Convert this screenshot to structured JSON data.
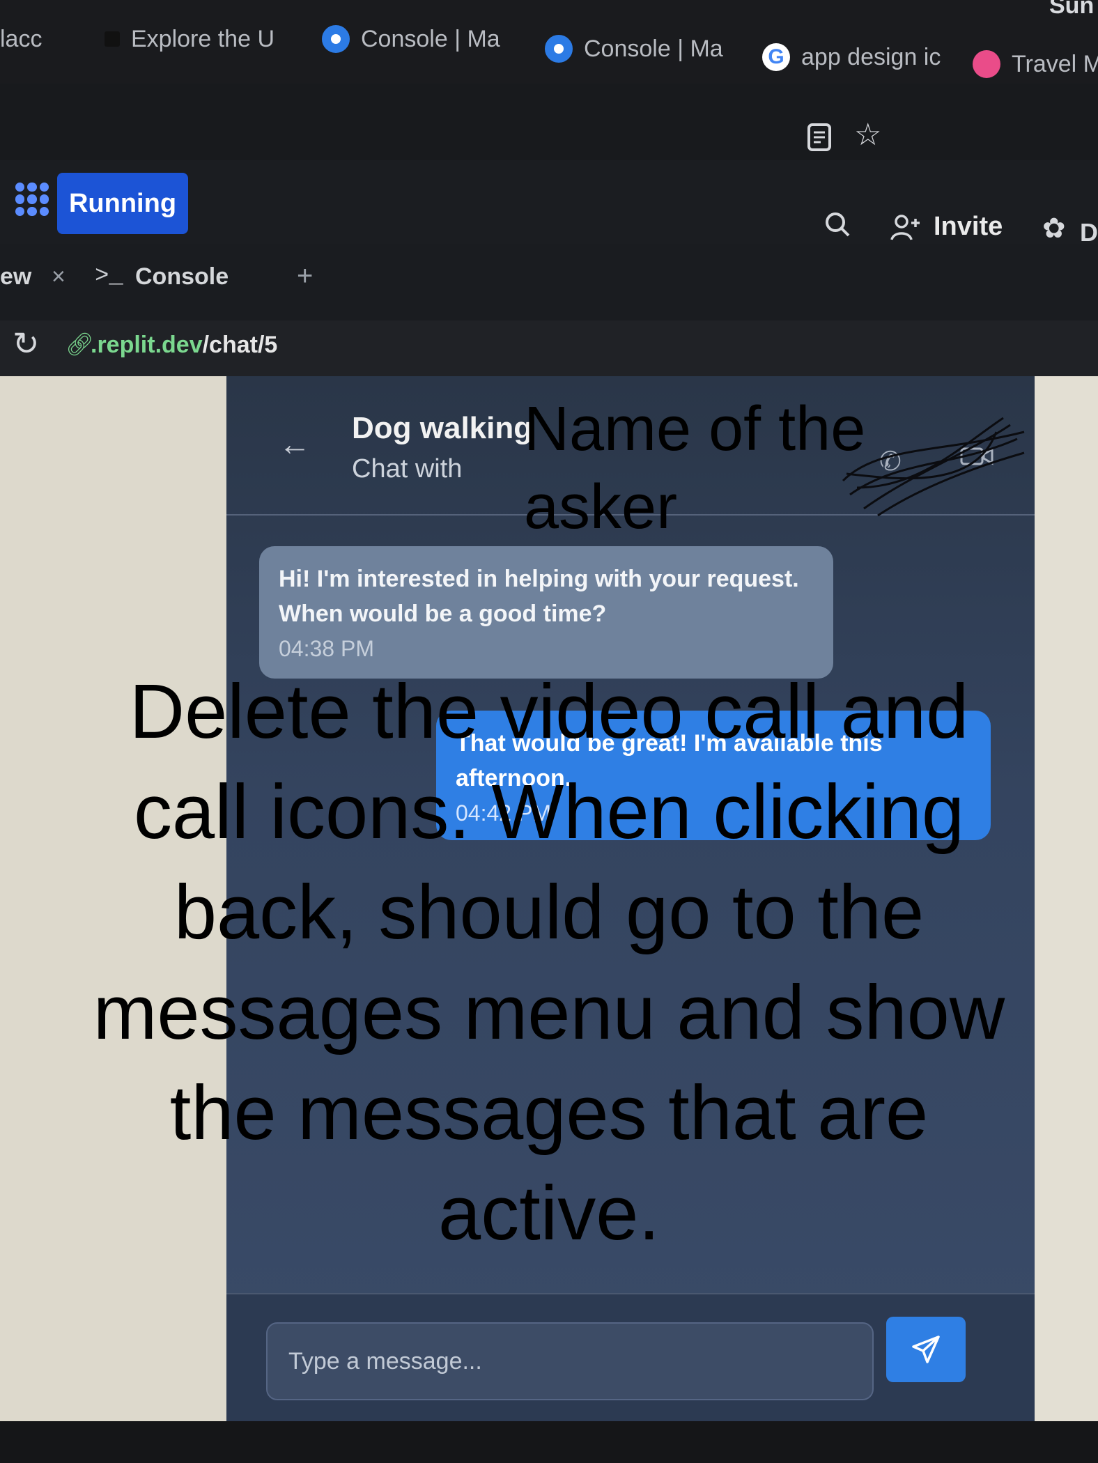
{
  "browser": {
    "tabs": [
      {
        "label": "lacc",
        "icon": "partial-tab-icon"
      },
      {
        "label": "Explore the U",
        "icon": "square-favicon-icon"
      },
      {
        "label": "Console | Ma",
        "icon": "console-favicon-icon"
      },
      {
        "label": "Console | Ma",
        "icon": "console-favicon-icon"
      },
      {
        "label": "app design ic",
        "icon": "google-favicon-icon"
      },
      {
        "label": "Travel Mo",
        "icon": "dribbble-favicon-icon"
      }
    ],
    "partial_top_right": "Sun",
    "url_host": ".replit.dev",
    "url_path": "/chat/5",
    "google_g": "G"
  },
  "replit": {
    "status": "Running",
    "invite_label": "Invite",
    "partial_right_label": "D",
    "tabs": [
      {
        "label": "ew"
      },
      {
        "label": "Console"
      }
    ],
    "add_tab": "+",
    "close_tab": "×",
    "console_prompt": ">_"
  },
  "chat": {
    "title": "Dog walking",
    "subtitle": "Chat with",
    "messages": [
      {
        "text": "Hi! I'm interested in helping with your request. When would be a good time?",
        "time": "04:38 PM",
        "direction": "incoming"
      },
      {
        "text": "That would be great! I'm available this afternoon.",
        "time": "04:42 PM",
        "direction": "outgoing"
      }
    ],
    "input_placeholder": "Type a message..."
  },
  "annotations": {
    "header_note": "Name of the asker",
    "main_note": "Delete the video call and call icons. When clicking back, should go to the messages menu and show the messages that are active."
  },
  "colors": {
    "running_button": "#1c54d6",
    "outgoing_bubble": "#2f7fe4",
    "incoming_bubble": "#6f829c",
    "url_green": "#7bd88f"
  }
}
